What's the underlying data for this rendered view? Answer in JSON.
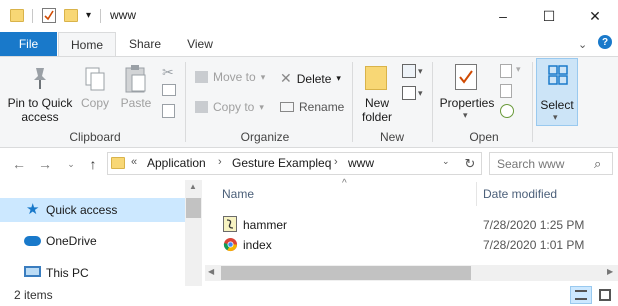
{
  "window": {
    "title": "www",
    "minimize_glyph": "–",
    "maximize_glyph": "☐",
    "close_glyph": "✕"
  },
  "tabs": {
    "file": "File",
    "home": "Home",
    "share": "Share",
    "view": "View"
  },
  "ribbon": {
    "clipboard": {
      "pin_label": "Pin to Quick access",
      "copy_label": "Copy",
      "paste_label": "Paste",
      "group_label": "Clipboard"
    },
    "organize": {
      "move_to": "Move to",
      "copy_to": "Copy to",
      "delete": "Delete",
      "rename": "Rename",
      "group_label": "Organize"
    },
    "new": {
      "new_folder": "New folder",
      "group_label": "New"
    },
    "open": {
      "properties": "Properties",
      "group_label": "Open"
    },
    "select": {
      "select_label": "Select"
    }
  },
  "address": {
    "overflow": "«",
    "crumbs": [
      "Application",
      "Gesture Exampleq",
      "www"
    ],
    "search_placeholder": "Search www"
  },
  "navpane": {
    "items": [
      "Quick access",
      "OneDrive",
      "This PC"
    ]
  },
  "filelist": {
    "columns": {
      "name": "Name",
      "date": "Date modified"
    },
    "rows": [
      {
        "name": "hammer",
        "date": "7/28/2020 1:25 PM",
        "icon": "script-file-icon"
      },
      {
        "name": "index",
        "date": "7/28/2020 1:01 PM",
        "icon": "chrome-html-icon"
      }
    ]
  },
  "status": {
    "items_count": "2 items"
  },
  "colors": {
    "file_tab": "#1979ca",
    "ribbon_bg": "#f5f6f7",
    "selected_nav": "#cce8ff"
  }
}
